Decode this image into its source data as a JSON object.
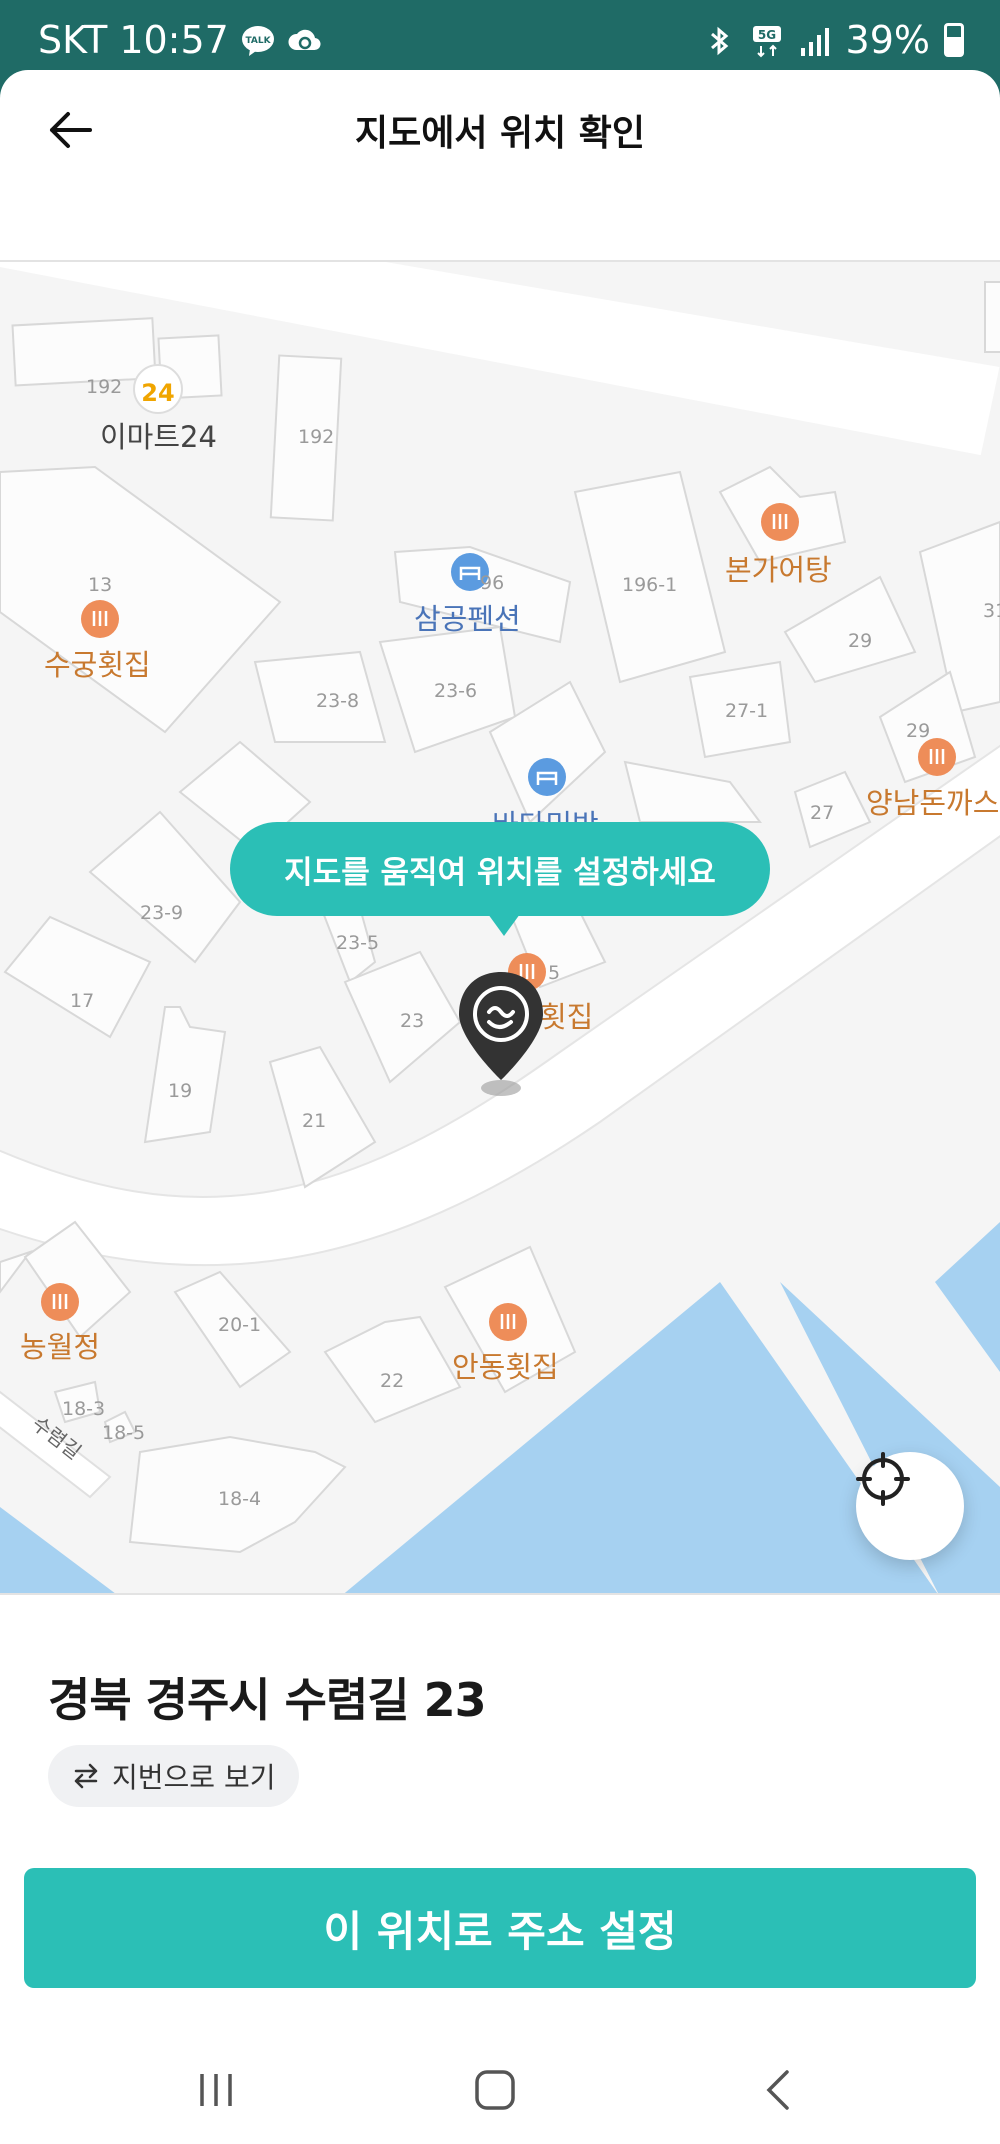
{
  "status_bar": {
    "carrier": "SKT",
    "time": "10:57",
    "talk_badge": "TALK",
    "network": "5G",
    "battery": "39%"
  },
  "header": {
    "title": "지도에서 위치 확인"
  },
  "map": {
    "tooltip": "지도를 움직여 위치를 설정하세요",
    "pois": [
      {
        "label": "이마트24",
        "logo": "24"
      },
      {
        "label": "삼공펜션"
      },
      {
        "label": "본가어탕"
      },
      {
        "label": "수궁횟집"
      },
      {
        "label": "바다민박"
      },
      {
        "label": "양남돈까스"
      },
      {
        "label": "횟집"
      },
      {
        "label": "농월정"
      },
      {
        "label": "안동횟집"
      }
    ],
    "numbers": [
      "192",
      "192",
      "13",
      "96",
      "196-1",
      "31",
      "29",
      "23-8",
      "23-6",
      "27-1",
      "29",
      "27",
      "23-9",
      "23-5",
      "5",
      "17",
      "23",
      "19",
      "21",
      "20-1",
      "22",
      "18-3",
      "18-5",
      "18-4"
    ],
    "road": "수렴길"
  },
  "address": {
    "road_address": "경북 경주시 수렴길 23",
    "toggle_label": "지번으로 보기"
  },
  "actions": {
    "confirm_label": "이 위치로 주소 설정"
  },
  "colors": {
    "accent": "#2bbfb6",
    "status_bar": "#1f6b66",
    "water": "#a6d1f1",
    "poi_food": "#ee8d59",
    "poi_lodging": "#5b9be0"
  }
}
